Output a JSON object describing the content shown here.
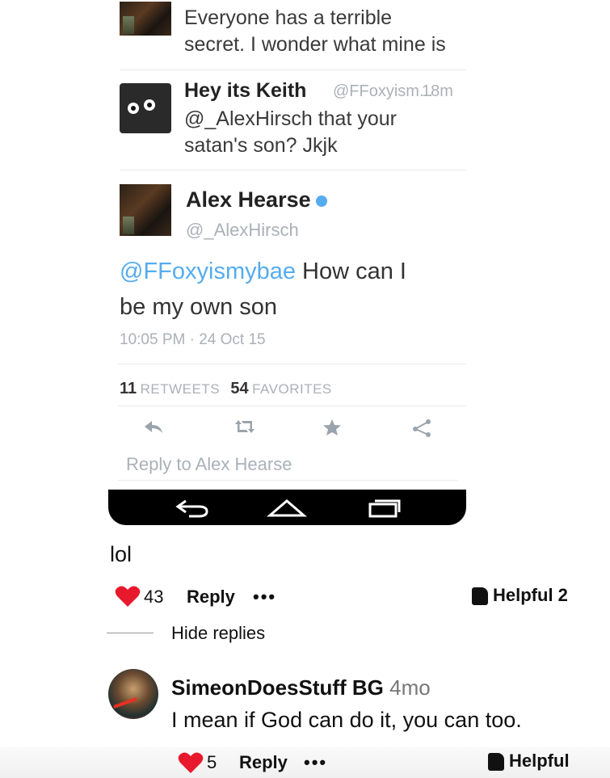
{
  "tweets": {
    "top_text": [
      "Everyone has a terrible",
      "secret. I wonder what mine is"
    ],
    "keith": {
      "name": "Hey its Keith",
      "handle": "@FFoxyism...",
      "time": "18m",
      "text": [
        "@_AlexHirsch that your",
        "satan's son? Jkjk"
      ]
    },
    "alex": {
      "name": "Alex Hearse",
      "handle": "@_AlexHirsch",
      "mention": "@FFoxyismybae",
      "text_after_mention": " How can I",
      "text_line2": "be my own son",
      "timestamp": "10:05 PM · 24 Oct 15",
      "retweets_count": "11",
      "retweets_label": "RETWEETS",
      "favorites_count": "54",
      "favorites_label": "FAVORITES"
    },
    "actions": [
      "reply-icon",
      "retweet-icon",
      "star-icon",
      "share-icon"
    ],
    "reply_placeholder": "Reply to Alex Hearse"
  },
  "navbar": {
    "icons": [
      "back-icon",
      "home-icon",
      "recents-icon"
    ]
  },
  "comment": {
    "text": "lol",
    "like_count": "43",
    "reply_label": "Reply",
    "more_label": "•••",
    "helpful_label": "Helpful 2",
    "hide_replies_label": "Hide replies"
  },
  "reply": {
    "username": "SimeonDoesStuff BG",
    "age": "4mo",
    "text": "I mean if God can do it, you can too.",
    "like_count": "5",
    "reply_label": "Reply",
    "more_label": "•••",
    "helpful_label": "Helpful"
  },
  "colors": {
    "twitter_blue": "#55acee",
    "heart_red": "#e8192c"
  }
}
